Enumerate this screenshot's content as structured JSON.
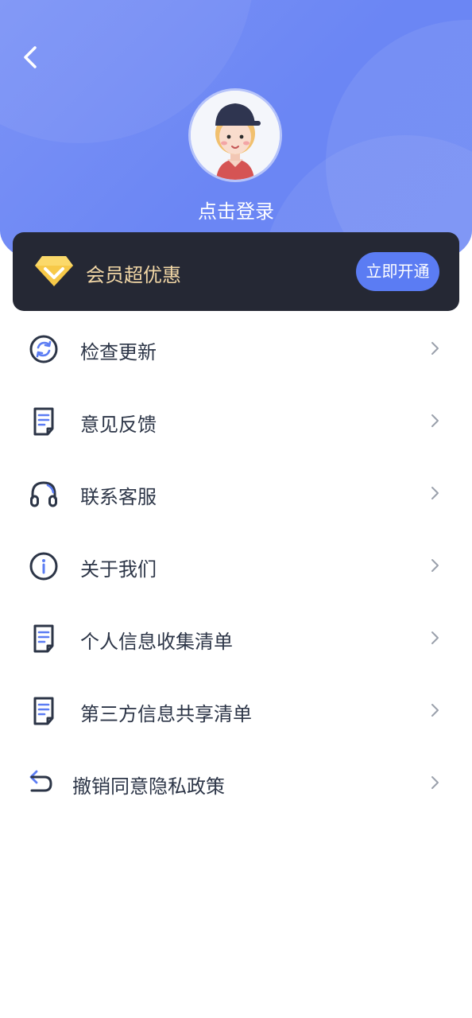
{
  "header": {
    "login_label": "点击登录"
  },
  "vip": {
    "title": "会员超优惠",
    "button_label": "立即开通"
  },
  "menu": {
    "items": [
      {
        "label": "检查更新",
        "icon": "refresh-icon"
      },
      {
        "label": "意见反馈",
        "icon": "document-icon"
      },
      {
        "label": "联系客服",
        "icon": "headphones-icon"
      },
      {
        "label": "关于我们",
        "icon": "info-icon"
      },
      {
        "label": "个人信息收集清单",
        "icon": "document-icon"
      },
      {
        "label": "第三方信息共享清单",
        "icon": "document-icon"
      },
      {
        "label": "撤销同意隐私政策",
        "icon": "undo-icon"
      }
    ]
  },
  "colors": {
    "header_gradient_start": "#7c93f6",
    "header_gradient_end": "#6c87f5",
    "vip_card": "#252834",
    "vip_text": "#f2d7a6",
    "accent_button": "#5b7cf3",
    "menu_text": "#2c3547"
  }
}
